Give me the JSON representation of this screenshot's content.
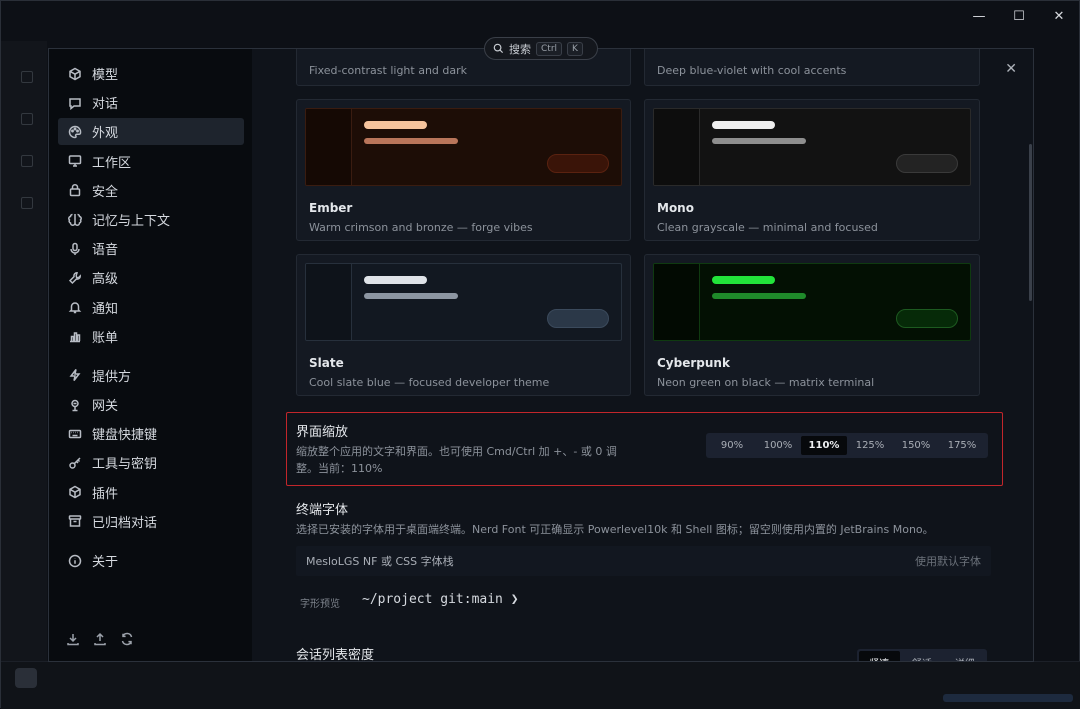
{
  "search": {
    "label": "搜索",
    "key1": "Ctrl",
    "key2": "K"
  },
  "window": {
    "minimize": "—",
    "maximize": "☐",
    "close": "✕"
  },
  "sidebar": {
    "items": [
      {
        "label": "模型",
        "icon": "cube-icon"
      },
      {
        "label": "对话",
        "icon": "chat-icon"
      },
      {
        "label": "外观",
        "icon": "palette-icon",
        "active": true
      },
      {
        "label": "工作区",
        "icon": "monitor-icon"
      },
      {
        "label": "安全",
        "icon": "lock-icon"
      },
      {
        "label": "记忆与上下文",
        "icon": "brain-icon"
      },
      {
        "label": "语音",
        "icon": "mic-icon"
      },
      {
        "label": "高级",
        "icon": "wrench-icon"
      },
      {
        "label": "通知",
        "icon": "bell-icon"
      },
      {
        "label": "账单",
        "icon": "chart-icon"
      },
      {
        "label": "提供方",
        "icon": "bolt-icon"
      },
      {
        "label": "网关",
        "icon": "gateway-icon"
      },
      {
        "label": "键盘快捷键",
        "icon": "keyboard-icon"
      },
      {
        "label": "工具与密钥",
        "icon": "key-icon"
      },
      {
        "label": "插件",
        "icon": "plugin-icon"
      },
      {
        "label": "已归档对话",
        "icon": "archive-icon"
      },
      {
        "label": "关于",
        "icon": "info-icon"
      }
    ]
  },
  "themes": {
    "top_left_desc": "Fixed-contrast light and dark",
    "top_right_desc": "Deep blue-violet with cool accents",
    "cards": [
      {
        "name": "Ember",
        "desc": "Warm crimson and bronze — forge vibes",
        "colors": {
          "bg": "#1d0d06",
          "strip": "#150904",
          "border": "#3a1c10",
          "bar1": "#f6c49d",
          "bar2": "#b9755a",
          "btn": "#3a1408",
          "btnBorder": "#5a2210"
        }
      },
      {
        "name": "Mono",
        "desc": "Clean grayscale — minimal and focused",
        "colors": {
          "bg": "#121212",
          "strip": "#0d0d0d",
          "border": "#2a2a2a",
          "bar1": "#eeeeee",
          "bar2": "#8e8e8e",
          "btn": "#232323",
          "btnBorder": "#3a3a3a"
        }
      },
      {
        "name": "Slate",
        "desc": "Cool slate blue — focused developer theme",
        "colors": {
          "bg": "#121821",
          "strip": "#0e131a",
          "border": "#27303c",
          "bar1": "#dfe3e8",
          "bar2": "#8d96a2",
          "btn": "#2b3848",
          "btnBorder": "#3b4a5c"
        }
      },
      {
        "name": "Cyberpunk",
        "desc": "Neon green on black — matrix terminal",
        "colors": {
          "bg": "#031003",
          "strip": "#020a02",
          "border": "#0f3a10",
          "bar1": "#22e33a",
          "bar2": "#1f8a2a",
          "btn": "#062a08",
          "btnBorder": "#1d5a20"
        }
      }
    ]
  },
  "zoom": {
    "title": "界面缩放",
    "desc": "缩放整个应用的文字和界面。也可使用 Cmd/Ctrl 加 +、- 或 0 调整。当前：110%",
    "options": [
      "90%",
      "100%",
      "110%",
      "125%",
      "150%",
      "175%"
    ],
    "selected": 2
  },
  "terminal_font": {
    "title": "终端字体",
    "desc": "选择已安装的字体用于桌面端终端。Nerd Font 可正确显示 Powerlevel10k 和 Shell 图标；留空则使用内置的 JetBrains Mono。",
    "placeholder": "MesloLGS NF 或 CSS 字体栈",
    "reset_label": "使用默认字体",
    "preview_label": "字形预览",
    "preview_sample": "~/project git:main ❯"
  },
  "density": {
    "title": "会话列表密度",
    "options": [
      "紧凑",
      "舒适",
      "详细"
    ],
    "selected": 0
  }
}
